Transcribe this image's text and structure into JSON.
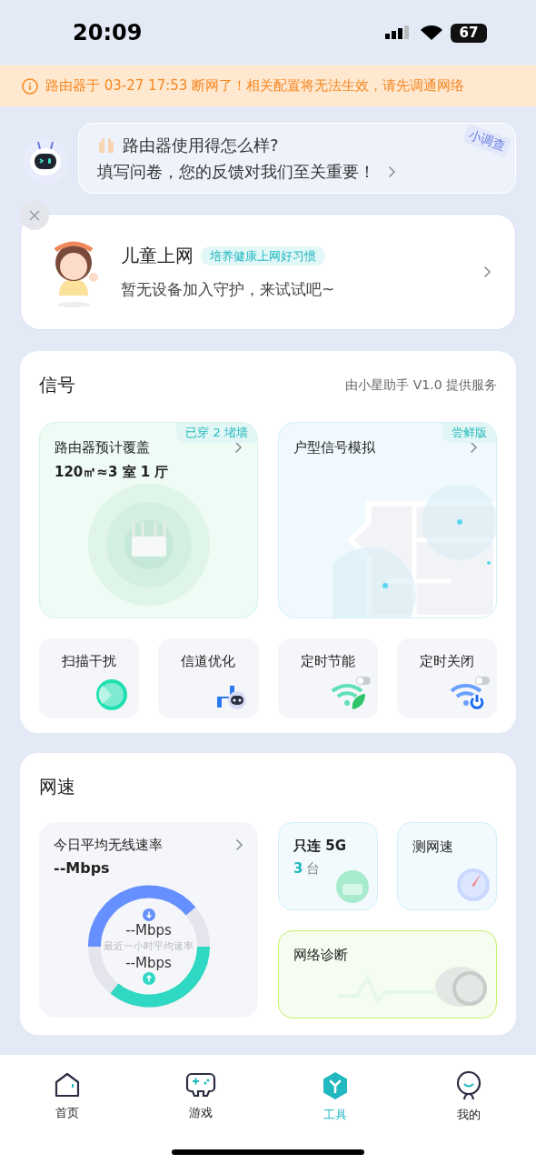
{
  "status_bar": {
    "time": "20:09",
    "battery": "67"
  },
  "alert": {
    "text": "路由器于 03-27 17:53 断网了！相关配置将无法生效，请先调通网络"
  },
  "survey": {
    "question": "路由器使用得怎么样?",
    "prompt": "填写问卷，您的反馈对我们至关重要！",
    "tag": "小调查"
  },
  "kids_card": {
    "title": "儿童上网",
    "tag": "培养健康上网好习惯",
    "subtitle": "暂无设备加入守护，来试试吧~"
  },
  "signal": {
    "title": "信号",
    "provider": "由小星助手 V1.0 提供服务",
    "coverage": {
      "title": "路由器预计覆盖",
      "value": "120㎡≈3 室 1 厅",
      "badge": "已穿 2 堵墙"
    },
    "floorplan": {
      "title": "户型信号模拟",
      "badge": "尝鲜版"
    },
    "tools": [
      {
        "label": "扫描干扰",
        "kind": "scan"
      },
      {
        "label": "信道优化",
        "kind": "channel"
      },
      {
        "label": "定时节能",
        "kind": "eco",
        "on": false
      },
      {
        "label": "定时关闭",
        "kind": "off",
        "on": false
      }
    ]
  },
  "speed": {
    "title": "网速",
    "average": {
      "title": "今日平均无线速率",
      "value": "--Mbps",
      "down": "--Mbps",
      "caption": "最近一小时平均速率",
      "up": "--Mbps"
    },
    "only_5g": {
      "title": "只连 5G",
      "count": "3",
      "unit": "台"
    },
    "speed_test": {
      "title": "测网速"
    },
    "diagnosis": {
      "title": "网络诊断"
    }
  },
  "tabs": [
    {
      "label": "首页",
      "kind": "home",
      "selected": false
    },
    {
      "label": "游戏",
      "kind": "game",
      "selected": false
    },
    {
      "label": "工具",
      "kind": "tools",
      "selected": true
    },
    {
      "label": "我的",
      "kind": "me",
      "selected": false
    }
  ]
}
